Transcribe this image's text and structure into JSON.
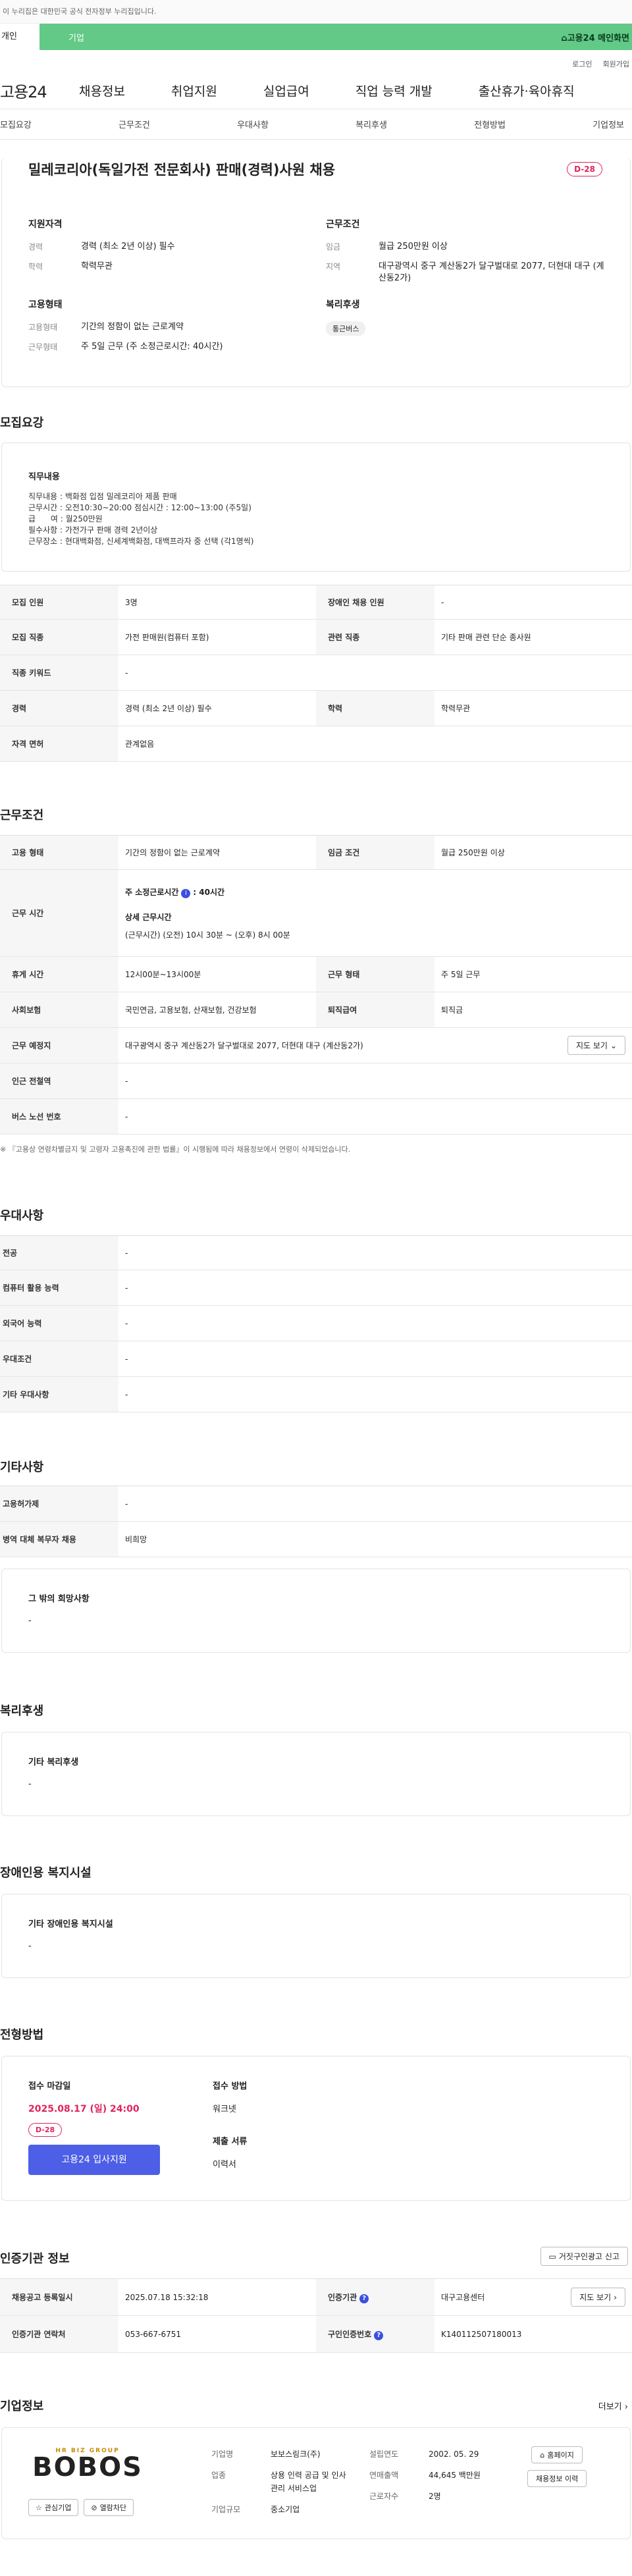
{
  "gov_banner": "이 누리집은 대한민국 공식 전자정부 누리집입니다.",
  "toggle": {
    "personal": "개인",
    "company": "기업",
    "brand": "고용24 메인화면"
  },
  "util": [
    "로그인",
    "회원가입"
  ],
  "gnb": {
    "logo": "고용24",
    "items": [
      "채용정보",
      "취업지원",
      "실업급여",
      "직업 능력 개발",
      "출산휴가·육아휴직"
    ]
  },
  "tabs": [
    "모집요강",
    "근무조건",
    "우대사항",
    "복리후생",
    "전형방법",
    "기업정보"
  ],
  "job": {
    "title": "밀레코리아(독일가전 전문회사) 판매(경력)사원 채용",
    "dday": "D-28",
    "qual_title": "지원자격",
    "career_k": "경력",
    "career_v": "경력 (최소 2년 이상) 필수",
    "edu_k": "학력",
    "edu_v": "학력무관",
    "cond_title": "근무조건",
    "wage_k": "임금",
    "wage_v": "월급 250만원 이상",
    "area_k": "지역",
    "area_v": "대구광역시 중구 계산동2가 달구벌대로 2077, 더현대 대구 (계산동2가)",
    "emp_title": "고용형태",
    "etype_k": "고용형태",
    "etype_v": "기간의 정함이 없는 근로계약",
    "wform_k": "근무형태",
    "wform_v": "주 5일 근무 (주 소정근로시간: 40시간)",
    "welfare_title": "복리후생",
    "welfare_chip": "통근버스"
  },
  "recruit": {
    "heading": "모집요강",
    "box_title": "직무내용",
    "box_lines": [
      "직무내용 : 백화점 입점 밀레코리아 제품 판매",
      "근무시간 : 오전10:30~20:00  점심시간 : 12:00~13:00 (주5일)",
      "급      여 : 월250만원",
      "필수사항 : 가전가구 판매 경력 2년이상",
      "근무장소 : 현대백화점, 신세계백화점, 대백프라자 중 선택 (각1명씩)"
    ],
    "rows": [
      {
        "k1": "모집 인원",
        "v1": "3명",
        "k2": "장애인 채용 인원",
        "v2": "-"
      },
      {
        "k1": "모집 직종",
        "v1": "가전 판매원(컴퓨터 포함)",
        "k2": "관련 직종",
        "v2": "기타 판매 관련 단순 종사원"
      },
      {
        "k1": "직종 키워드",
        "v1": "-"
      },
      {
        "k1": "경력",
        "v1": "경력 (최소 2년 이상) 필수",
        "k2": "학력",
        "v2": "학력무관"
      },
      {
        "k1": "자격 면허",
        "v1": "관계없음"
      }
    ]
  },
  "work": {
    "heading": "근무조건",
    "etype_k": "고용 형태",
    "etype_v": "기간의 정함이 없는 근로계약",
    "wage_k": "임금 조건",
    "wage_v": "월급 250만원 이상",
    "hours_k": "근무 시간",
    "hours_weekly": "주 소정근로시간",
    "hours_weekly_val": ": 40시간",
    "hours_detail_title": "상세 근무시간",
    "hours_detail": "(근무시간) (오전) 10시 30분 ~ (오후) 8시 00분",
    "rest_k": "휴게 시간",
    "rest_v": "12시00분~13시00분",
    "wform_k": "근무 형태",
    "wform_v": "주 5일 근무",
    "ins_k": "사회보험",
    "ins_v": "국민연금, 고용보험, 산재보험, 건강보험",
    "ret_k": "퇴직급여",
    "ret_v": "퇴직금",
    "loc_k": "근무 예정지",
    "loc_v": "대구광역시 중구 계산동2가 달구벌대로 2077, 더현대 대구 (계산동2가)",
    "map_btn": "지도 보기",
    "sub_k": "인근 전철역",
    "sub_v": "-",
    "bus_k": "버스 노선 번호",
    "bus_v": "-",
    "note": "※ 『고용상 연령차별금지 및 고령자 고용촉진에 관한 법률』이 시행됨에 따라 채용정보에서 연령이 삭제되었습니다."
  },
  "pref": {
    "heading": "우대사항",
    "rows": [
      {
        "k": "전공",
        "v": "-"
      },
      {
        "k": "컴퓨터 활용 능력",
        "v": "-"
      },
      {
        "k": "외국어 능력",
        "v": "-"
      },
      {
        "k": "우대조건",
        "v": "-"
      },
      {
        "k": "기타 우대사항",
        "v": "-"
      }
    ]
  },
  "etc": {
    "heading": "기타사항",
    "rows": [
      {
        "k": "고용허가제",
        "v": "-"
      },
      {
        "k": "병역 대체 복무자 채용",
        "v": "비희망"
      }
    ],
    "box_title": "그 밖의 희망사항",
    "box_val": "-"
  },
  "welfare": {
    "heading": "복리후생",
    "box_title": "기타 복리후생",
    "box_val": "-"
  },
  "disabled": {
    "heading": "장애인용 복지시설",
    "box_title": "기타 장애인용 복지시설",
    "box_val": "-"
  },
  "selection": {
    "heading": "전형방법",
    "deadline_title": "접수 마감일",
    "deadline": "2025.08.17 (일) 24:00",
    "dday": "D-28",
    "apply_btn": "고용24 입사지원",
    "method_title": "접수 방법",
    "method": "워크넷",
    "docs_title": "제출 서류",
    "docs": "이력서"
  },
  "cert": {
    "heading": "인증기관 정보",
    "report_btn": "거짓구인광고 신고",
    "reg_k": "채용공고 등록일시",
    "reg_v": "2025.07.18 15:32:18",
    "org_k": "인증기관",
    "org_v": "대구고용센터",
    "map_btn": "지도 보기",
    "tel_k": "인증기관 연락처",
    "tel_v": "053-667-6751",
    "no_k": "구인인증번호",
    "no_v": "K140112507180013"
  },
  "company": {
    "heading": "기업정보",
    "more": "더보기",
    "logo_top": "HR BIZ GROUP",
    "logo_name": "BOBOS",
    "fav_btn": "관심기업",
    "block_btn": "열람차단",
    "name_k": "기업명",
    "name_v": "보보스링크(주)",
    "biz_k": "업종",
    "biz_v": "상용 인력 공급 및 인사관리 서비스업",
    "size_k": "기업규모",
    "size_v": "중소기업",
    "year_k": "설립연도",
    "year_v": "2002. 05. 29",
    "sales_k": "연매출액",
    "sales_v": "44,645 백만원",
    "emp_k": "근로자수",
    "emp_v": "2명",
    "home_btn": "홈페이지",
    "history_btn": "채용정보 이력"
  }
}
